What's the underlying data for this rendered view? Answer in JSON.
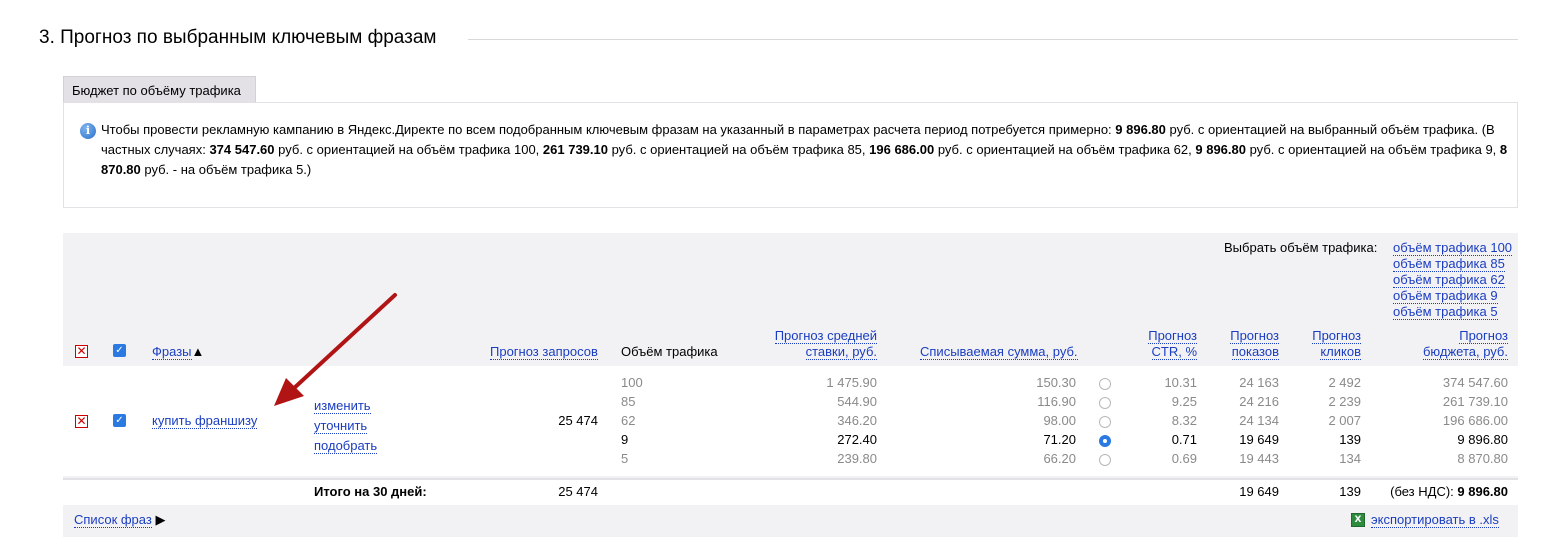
{
  "section": {
    "title": "3. Прогноз по выбранным ключевым фразам"
  },
  "budget": {
    "tab_label": "Бюджет по объёму трафика",
    "info": {
      "t1": "Чтобы провести рекламную кампанию в Яндекс.Директе по всем подобранным ключевым фразам на указанный в параметрах расчета период потребуется примерно: ",
      "b1": "9 896.80",
      "t2": " руб. с ориентацией на выбранный объём трафика. (В частных случаях: ",
      "b2": "374 547.60",
      "t3": " руб. с ориентацией на объём трафика 100, ",
      "b3": "261 739.10",
      "t4": " руб. с ориентацией на объём трафика 85, ",
      "b4": "196 686.00",
      "t5": " руб. с ориентацией на объём трафика 62, ",
      "b5": "9 896.80",
      "t6": " руб. с ориентацией на объём трафика 9, ",
      "b6": "8 870.80",
      "t7": " руб. - на объём трафика 5.)"
    }
  },
  "traffic_select": {
    "label": "Выбрать объём трафика:",
    "options": [
      "объём трафика 100",
      "объём трафика 85",
      "объём трафика 62",
      "объём трафика 9",
      "объём трафика 5"
    ]
  },
  "headers": {
    "phrases": "Фразы",
    "phrases_sort": "▲",
    "requests": "Прогноз запросов",
    "traffic": "Объём трафика",
    "avg_bid_1": "Прогноз средней",
    "avg_bid_2": "ставки, руб.",
    "charge": "Списываемая сумма, руб.",
    "ctr_1": "Прогноз",
    "ctr_2": "CTR, %",
    "shows_1": "Прогноз",
    "shows_2": "показов",
    "clicks_1": "Прогноз",
    "clicks_2": "кликов",
    "budget_1": "Прогноз",
    "budget_2": "бюджета, руб."
  },
  "phrase": {
    "text": "купить франшизу",
    "actions": [
      "изменить",
      "уточнить",
      "подобрать"
    ],
    "requests": "25 474"
  },
  "rows": [
    {
      "traffic": "100",
      "bid": "1 475.90",
      "charge": "150.30",
      "ctr": "10.31",
      "shows": "24 163",
      "clicks": "2 492",
      "budget": "374 547.60",
      "selected": false
    },
    {
      "traffic": "85",
      "bid": "544.90",
      "charge": "116.90",
      "ctr": "9.25",
      "shows": "24 216",
      "clicks": "2 239",
      "budget": "261 739.10",
      "selected": false
    },
    {
      "traffic": "62",
      "bid": "346.20",
      "charge": "98.00",
      "ctr": "8.32",
      "shows": "24 134",
      "clicks": "2 007",
      "budget": "196 686.00",
      "selected": false
    },
    {
      "traffic": "9",
      "bid": "272.40",
      "charge": "71.20",
      "ctr": "0.71",
      "shows": "19 649",
      "clicks": "139",
      "budget": "9 896.80",
      "selected": true
    },
    {
      "traffic": "5",
      "bid": "239.80",
      "charge": "66.20",
      "ctr": "0.69",
      "shows": "19 443",
      "clicks": "134",
      "budget": "8 870.80",
      "selected": false
    }
  ],
  "total": {
    "label": "Итого на 30 дней:",
    "requests": "25 474",
    "shows": "19 649",
    "clicks": "139",
    "budget_prefix": "(без НДС): ",
    "budget": "9 896.80"
  },
  "footer": {
    "phrase_list": "Список фраз",
    "phrase_list_arrow": "▶",
    "export": "экспортировать в .xls"
  },
  "colors": {
    "link": "#1a3dc1",
    "accent": "#2a7ae2",
    "arrow": "#b01414",
    "panel": "#f2f2f4"
  }
}
